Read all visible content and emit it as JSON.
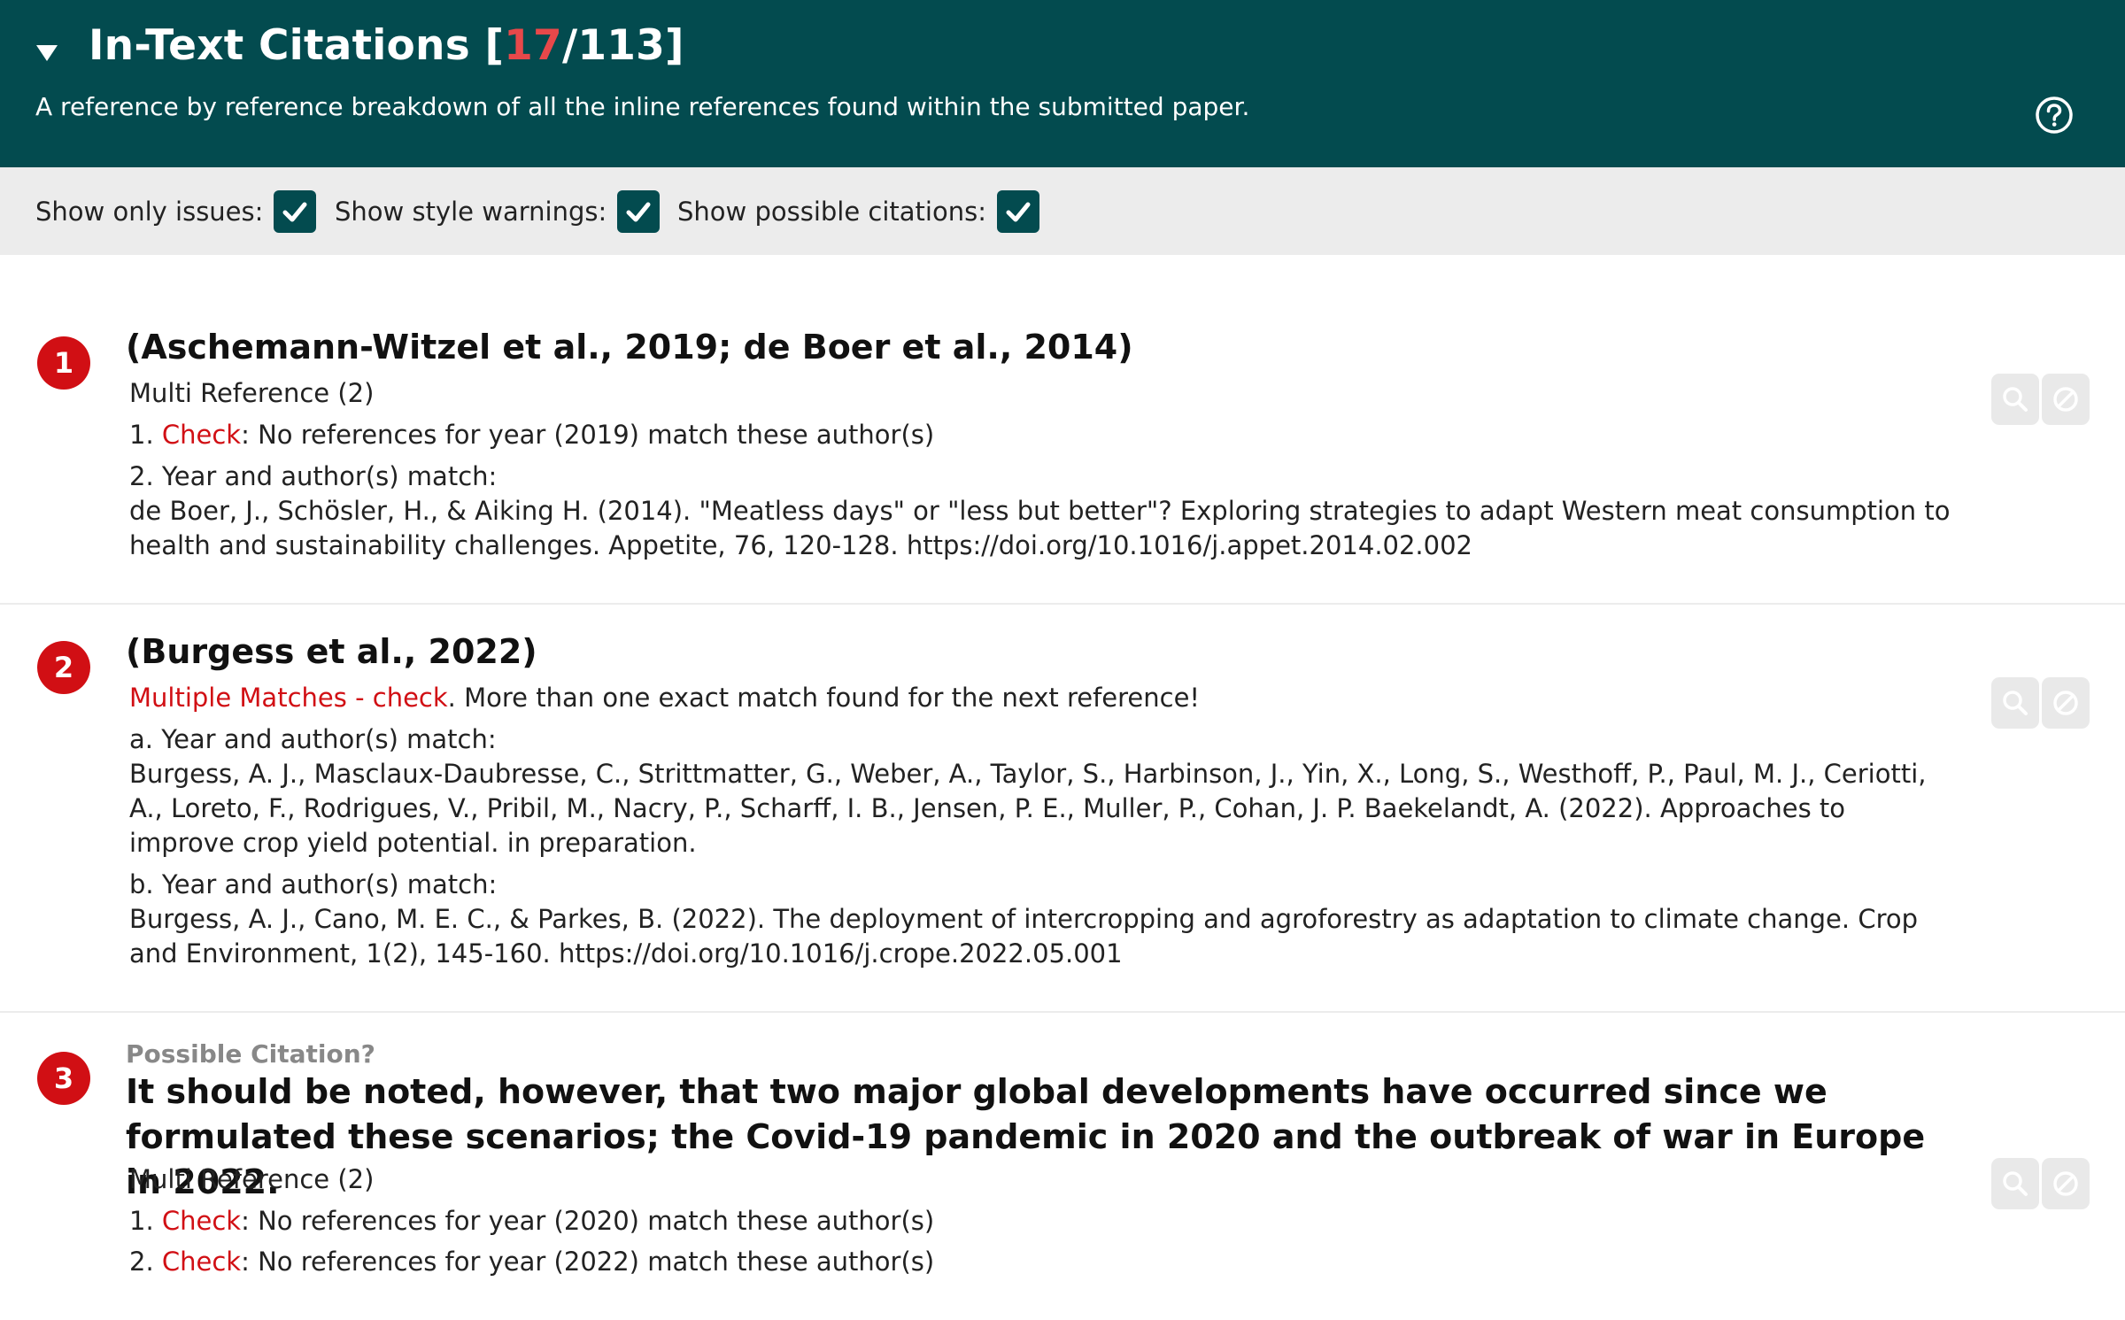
{
  "header": {
    "title_prefix": "In-Text Citations [",
    "count_issues": "17",
    "count_separator": "/",
    "count_total": "113",
    "title_suffix": "]",
    "subtitle": "A reference by reference breakdown of all the inline references found within the submitted paper.",
    "collapse_icon": "triangle-down-icon",
    "help_icon": "question-circle-icon"
  },
  "filters": [
    {
      "label": "Show only issues:",
      "checked": true
    },
    {
      "label": "Show style warnings:",
      "checked": true
    },
    {
      "label": "Show possible citations:",
      "checked": true
    }
  ],
  "citations": [
    {
      "number": "1",
      "title": "(Aschemann-Witzel et al., 2019; de Boer et al., 2014)",
      "type_label": "Multi Reference (2)",
      "item1_prefix": "1. ",
      "item1_check": "Check",
      "item1_text": ": No references for year (2019) match these author(s)",
      "item2_label": "2. Year and author(s) match:",
      "item2_ref": "de Boer, J., Schösler, H., & Aiking H. (2014). \"Meatless days\" or \"less but better\"? Exploring strategies to adapt Western meat consumption to health and sustainability challenges. Appetite, 76, 120-128. https://doi.org/10.1016/j.appet.2014.02.002"
    },
    {
      "number": "2",
      "title": "(Burgess et al., 2022)",
      "warning_red": "Multiple Matches - check",
      "warning_text": ". More than one exact match found for the next reference!",
      "a_label": "a. Year and author(s) match:",
      "a_ref": "Burgess, A. J., Masclaux-Daubresse, C., Strittmatter, G., Weber, A., Taylor, S., Harbinson, J., Yin, X., Long, S., Westhoff, P., Paul, M. J., Ceriotti, A., Loreto, F., Rodrigues, V., Pribil, M., Nacry, P., Scharff, I. B., Jensen, P. E., Muller, P., Cohan, J. P. Baekelandt, A. (2022). Approaches to improve crop yield potential. in preparation.",
      "b_label": "b. Year and author(s) match:",
      "b_ref": "Burgess, A. J., Cano, M. E. C., & Parkes, B. (2022). The deployment of intercropping and agroforestry as adaptation to climate change. Crop and Environment, 1(2), 145-160. https://doi.org/10.1016/j.crope.2022.05.001"
    },
    {
      "number": "3",
      "possible_label": "Possible Citation?",
      "title": "It should be noted, however, that two major global developments have occurred since we formulated these scenarios; the Covid-19 pandemic in 2020 and the outbreak of war in Europe in 2022.",
      "type_label": "Multi Reference (2)",
      "item1_prefix": "1. ",
      "item1_check": "Check",
      "item1_text": ": No references for year (2020) match these author(s)",
      "item2_prefix": "2. ",
      "item2_check": "Check",
      "item2_text": ": No references for year (2022) match these author(s)"
    }
  ],
  "actions": {
    "search_icon": "search-icon",
    "ignore_icon": "block-icon"
  },
  "colors": {
    "header_bg": "#034b4f",
    "accent_red": "#d10f14",
    "count_red": "#e8484a",
    "filter_bar_bg": "#ececec"
  }
}
